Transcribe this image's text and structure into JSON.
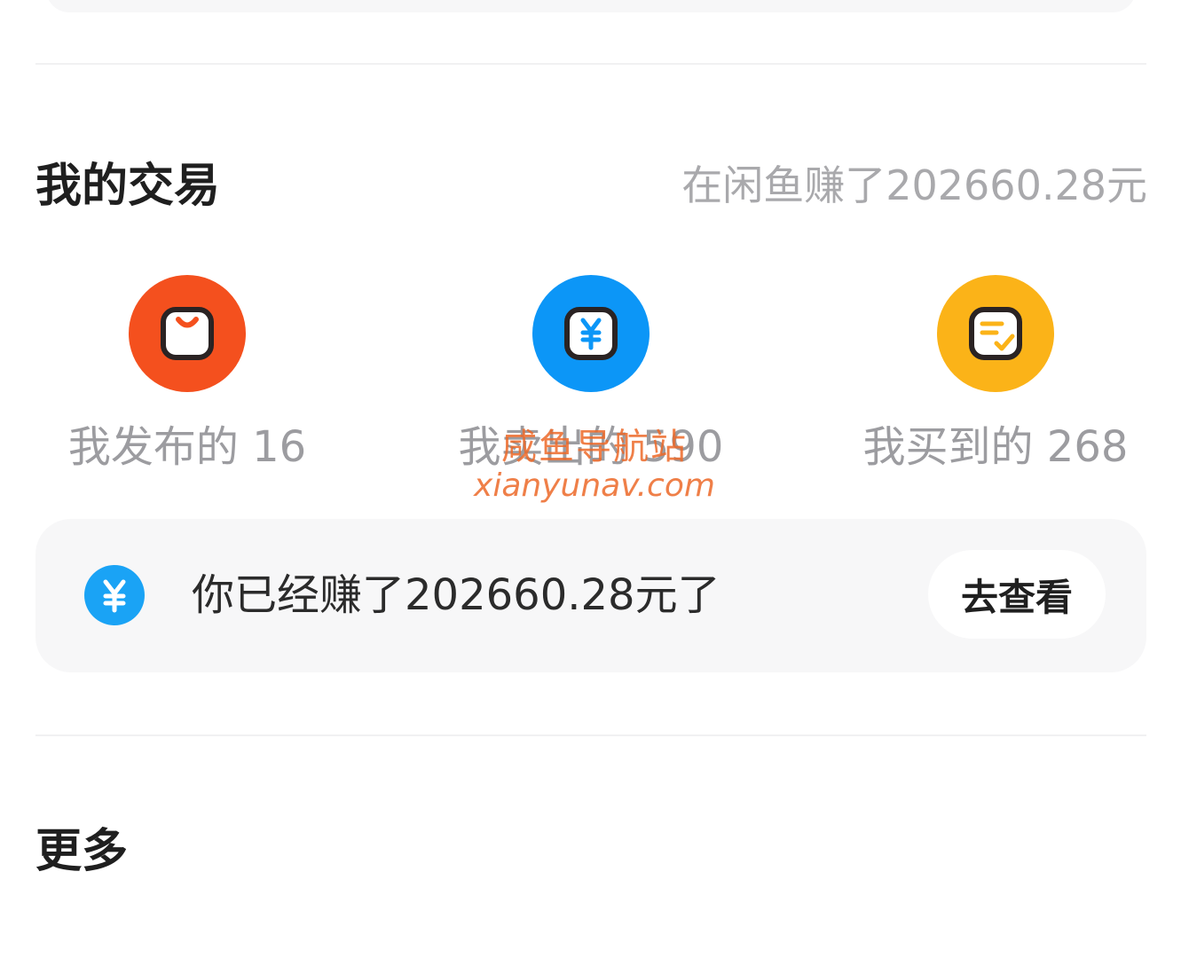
{
  "trade": {
    "title": "我的交易",
    "earned_summary": "在闲鱼赚了202660.28元",
    "entries": [
      {
        "label": "我发布的 16",
        "icon": "shopping-bag-icon",
        "color": "#F4501E"
      },
      {
        "label": "我卖出的 590",
        "icon": "yuan-icon",
        "color": "#0C96F7"
      },
      {
        "label": "我买到的 268",
        "icon": "order-check-icon",
        "color": "#FBB318"
      }
    ]
  },
  "earn_card": {
    "text": "你已经赚了202660.28元了",
    "button_label": "去查看",
    "icon": "yuan-coin-icon",
    "icon_color": "#1AA3F5"
  },
  "more": {
    "title": "更多"
  },
  "watermark": {
    "line1": "咸鱼导航站",
    "line2": "xianyunav.com"
  }
}
